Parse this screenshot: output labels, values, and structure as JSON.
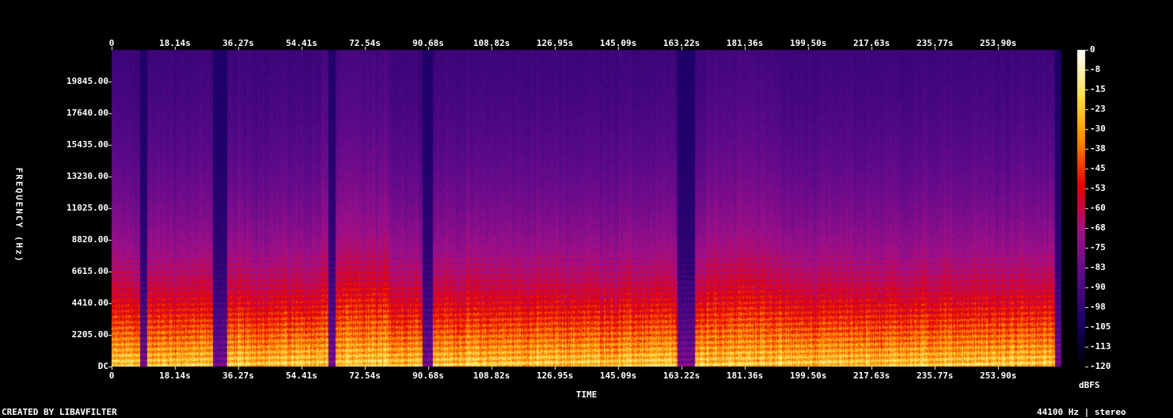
{
  "chart_data": {
    "type": "heatmap",
    "title": "",
    "xlabel": "TIME",
    "ylabel": "FREQUENCY (Hz)",
    "x_ticks": [
      "0",
      "18.14s",
      "36.27s",
      "54.41s",
      "72.54s",
      "90.68s",
      "108.82s",
      "126.95s",
      "145.09s",
      "163.22s",
      "181.36s",
      "199.50s",
      "217.63s",
      "235.77s",
      "253.90s"
    ],
    "x_tick_values": [
      0,
      18.14,
      36.27,
      54.41,
      72.54,
      90.68,
      108.82,
      126.95,
      145.09,
      163.22,
      181.36,
      199.5,
      217.63,
      235.77,
      253.9
    ],
    "xlim": [
      0,
      272
    ],
    "y_ticks": [
      "DC",
      "2205.00",
      "4410.00",
      "6615.00",
      "8820.00",
      "11025.00",
      "13230.00",
      "15435.00",
      "17640.00",
      "19845.00"
    ],
    "y_tick_values": [
      0,
      2205,
      4410,
      6615,
      8820,
      11025,
      13230,
      15435,
      17640,
      19845
    ],
    "ylim": [
      0,
      22050
    ],
    "colorbar": {
      "label": "dBFS",
      "ticks": [
        "0",
        "-8",
        "-15",
        "-23",
        "-30",
        "-38",
        "-45",
        "-53",
        "-60",
        "-68",
        "-75",
        "-83",
        "-90",
        "-98",
        "-105",
        "-113",
        "-120"
      ],
      "range": [
        -120,
        0
      ]
    },
    "colors": [
      "#000000",
      "#1a0066",
      "#5c0a8a",
      "#a3108a",
      "#e60000",
      "#ff8a00",
      "#ffe24d",
      "#ffffff"
    ]
  },
  "footer": {
    "left": "CREATED BY LIBAVFILTER",
    "right": "44100 Hz | stereo"
  }
}
